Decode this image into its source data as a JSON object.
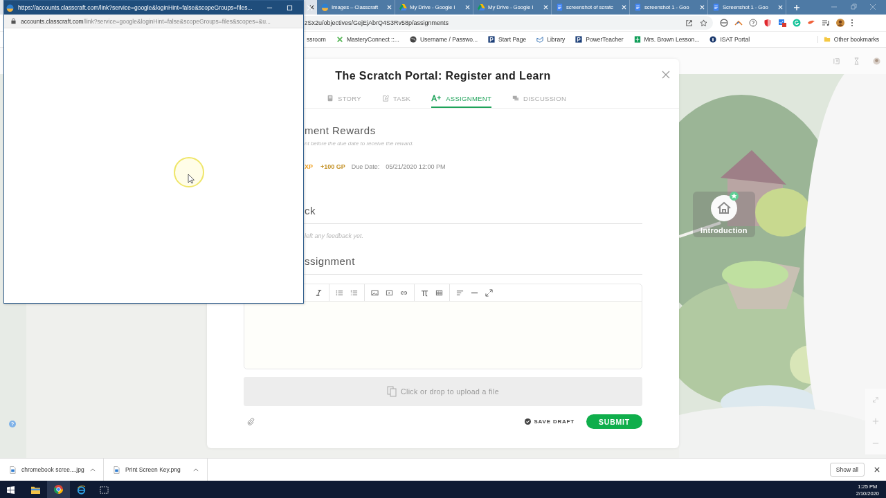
{
  "browser": {
    "tabs": [
      {
        "kind": "covered",
        "selected": true
      },
      {
        "kind": "site",
        "title": "Images – Classcraft",
        "selected": false
      },
      {
        "kind": "drive",
        "title": "My Drive - Google I",
        "selected": false
      },
      {
        "kind": "drive",
        "title": "My Drive - Google I",
        "selected": false
      },
      {
        "kind": "doc",
        "title": "screenshot of scratc",
        "selected": false
      },
      {
        "kind": "doc",
        "title": "screenshot 1 - Goo",
        "selected": false
      },
      {
        "kind": "doc",
        "title": "Screenshot 1 - Goo",
        "selected": false
      }
    ],
    "address": "zSx2u/objectives/GejEjAbrQ4S3Rv58p/assignments",
    "bookmarks": [
      {
        "kind": "none",
        "label": "ssroom"
      },
      {
        "kind": "apps",
        "label": "MasteryConnect ::..."
      },
      {
        "kind": "globe",
        "label": "Username / Passwo..."
      },
      {
        "kind": "p",
        "label": "Start Page"
      },
      {
        "kind": "book",
        "label": "Library"
      },
      {
        "kind": "p",
        "label": "PowerTeacher"
      },
      {
        "kind": "sheet",
        "label": "Mrs. Brown Lesson..."
      },
      {
        "kind": "isat",
        "label": "ISAT Portal"
      }
    ],
    "other_bookmarks": "Other bookmarks"
  },
  "popup": {
    "title": "https://accounts.classcraft.com/link?service=google&loginHint=false&scopeGroups=files...",
    "url_host": "accounts.classcraft.com",
    "url_path": "/link?service=google&loginHint=false&scopeGroups=files&scopes=&u..."
  },
  "modal": {
    "title": "The Scratch Portal: Register and Learn",
    "tabs": [
      {
        "kind": "story",
        "label": "STORY",
        "selected": false
      },
      {
        "kind": "task",
        "label": "TASK",
        "selected": false
      },
      {
        "kind": "assignment",
        "label": "ASSIGNMENT",
        "selected": true
      },
      {
        "kind": "discussion",
        "label": "DISCUSSION",
        "selected": false
      }
    ],
    "rewards_heading": "ment Rewards",
    "rewards_note": "nt before the due date to receive the reward.",
    "xp": "XP",
    "gp": "+100 GP",
    "due_label": "Due Date:",
    "due_date": "05/21/2020 12:00 PM",
    "feedback_heading": "ck",
    "feedback_note": "left any feedback yet.",
    "assignment_heading": "ssignment",
    "upload": "Click or drop to upload a file",
    "save_draft": "SAVE DRAFT",
    "submit": "SUBMIT"
  },
  "map": {
    "node_label": "Introduction"
  },
  "downloads": {
    "items": [
      {
        "name": "chromebook scree....jpg"
      },
      {
        "name": "Print Screen Key.png"
      }
    ],
    "show_all": "Show all"
  },
  "taskbar": {
    "apps": [
      {
        "kind": "explorer",
        "selected": false
      },
      {
        "kind": "chrome",
        "selected": true
      },
      {
        "kind": "ie",
        "selected": false
      },
      {
        "kind": "snip",
        "selected": false
      }
    ],
    "time": "1:25 PM",
    "date": "2/10/2020"
  }
}
